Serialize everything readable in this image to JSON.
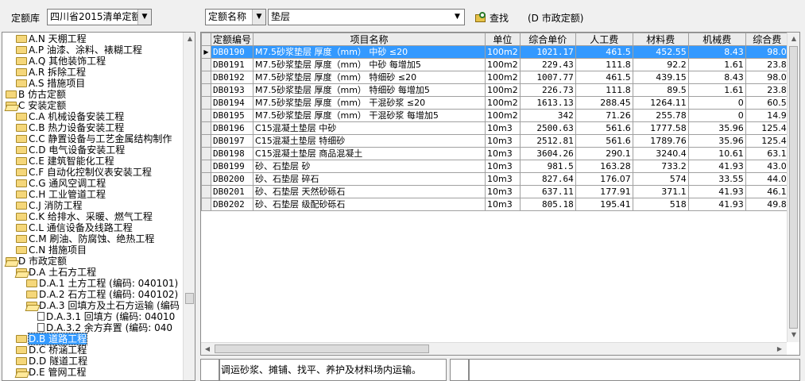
{
  "toolbar": {
    "library_label": "定额库",
    "library_value": "四川省2015清单定额",
    "field_value": "定额名称",
    "search_value": "垫层",
    "find_label": "查找",
    "status": "(D 市政定额)"
  },
  "tree": {
    "rows": [
      {
        "label": "A.N 天棚工程",
        "type": "folder"
      },
      {
        "label": "A.P 油漆、涂料、裱糊工程",
        "type": "folder"
      },
      {
        "label": "A.Q 其他装饰工程",
        "type": "folder"
      },
      {
        "label": "A.R 拆除工程",
        "type": "folder"
      },
      {
        "label": "A.S 措施项目",
        "type": "folder"
      },
      {
        "label": "B 仿古定额",
        "type": "folder"
      },
      {
        "label": "C 安装定额",
        "type": "folder-open"
      },
      {
        "label": "C.A 机械设备安装工程",
        "type": "folder"
      },
      {
        "label": "C.B 热力设备安装工程",
        "type": "folder"
      },
      {
        "label": "C.C 静置设备与工艺金属结构制作",
        "type": "folder"
      },
      {
        "label": "C.D 电气设备安装工程",
        "type": "folder"
      },
      {
        "label": "C.E 建筑智能化工程",
        "type": "folder"
      },
      {
        "label": "C.F 自动化控制仪表安装工程",
        "type": "folder"
      },
      {
        "label": "C.G 通风空调工程",
        "type": "folder"
      },
      {
        "label": "C.H 工业管道工程",
        "type": "folder"
      },
      {
        "label": "C.J 消防工程",
        "type": "folder"
      },
      {
        "label": "C.K 给排水、采暖、燃气工程",
        "type": "folder"
      },
      {
        "label": "C.L 通信设备及线路工程",
        "type": "folder"
      },
      {
        "label": "C.M 刷油、防腐蚀、绝热工程",
        "type": "folder"
      },
      {
        "label": "C.N 措施项目",
        "type": "folder"
      },
      {
        "label": "D 市政定额",
        "type": "folder-open"
      },
      {
        "label": "D.A 土石方工程",
        "type": "folder-open"
      },
      {
        "label": "D.A.1 土方工程 (编码: 040101)",
        "type": "folder"
      },
      {
        "label": "D.A.2 石方工程 (编码: 040102)",
        "type": "folder"
      },
      {
        "label": "D.A.3 回填方及土石方运输 (编码",
        "type": "folder-open"
      },
      {
        "label": "D.A.3.1 回填方 (编码: 04010",
        "type": "doc"
      },
      {
        "label": "D.A.3.2 余方弃置 (编码: 040",
        "type": "doc"
      },
      {
        "label": "D.B 道路工程",
        "type": "folder",
        "selected": true
      },
      {
        "label": "D.C 桥涵工程",
        "type": "folder"
      },
      {
        "label": "D.D 隧道工程",
        "type": "folder"
      },
      {
        "label": "D.E 管网工程",
        "type": "folder-open"
      }
    ]
  },
  "grid": {
    "columns": [
      "定额编号",
      "项目名称",
      "单位",
      "综合单价",
      "人工费",
      "材料费",
      "机械费",
      "综合费"
    ],
    "rows": [
      {
        "selected": true,
        "cells": [
          "DB0190",
          "M7.5砂浆垫层 厚度（mm） 中砂 ≤20",
          "100m2",
          "1021.17",
          "461.5",
          "452.55",
          "8.43",
          "98.0"
        ]
      },
      {
        "cells": [
          "DB0191",
          "M7.5砂浆垫层 厚度（mm） 中砂 每增加5",
          "100m2",
          "229.43",
          "111.8",
          "92.2",
          "1.61",
          "23.8"
        ]
      },
      {
        "cells": [
          "DB0192",
          "M7.5砂浆垫层 厚度（mm） 特细砂 ≤20",
          "100m2",
          "1007.77",
          "461.5",
          "439.15",
          "8.43",
          "98.0"
        ]
      },
      {
        "cells": [
          "DB0193",
          "M7.5砂浆垫层 厚度（mm） 特细砂 每增加5",
          "100m2",
          "226.73",
          "111.8",
          "89.5",
          "1.61",
          "23.8"
        ]
      },
      {
        "cells": [
          "DB0194",
          "M7.5砂浆垫层 厚度（mm） 干混砂浆 ≤20",
          "100m2",
          "1613.13",
          "288.45",
          "1264.11",
          "0",
          "60.5"
        ]
      },
      {
        "cells": [
          "DB0195",
          "M7.5砂浆垫层 厚度（mm） 干混砂浆 每增加5",
          "100m2",
          "342",
          "71.26",
          "255.78",
          "0",
          "14.9"
        ]
      },
      {
        "cells": [
          "DB0196",
          "C15混凝土垫层 中砂",
          "10m3",
          "2500.63",
          "561.6",
          "1777.58",
          "35.96",
          "125.4"
        ]
      },
      {
        "cells": [
          "DB0197",
          "C15混凝土垫层 特细砂",
          "10m3",
          "2512.81",
          "561.6",
          "1789.76",
          "35.96",
          "125.4"
        ]
      },
      {
        "cells": [
          "DB0198",
          "C15混凝土垫层 商品混凝土",
          "10m3",
          "3604.26",
          "290.1",
          "3240.4",
          "10.61",
          "63.1"
        ]
      },
      {
        "cells": [
          "DB0199",
          "砂、石垫层 砂",
          "10m3",
          "981.5",
          "163.28",
          "733.2",
          "41.93",
          "43.0"
        ]
      },
      {
        "cells": [
          "DB0200",
          "砂、石垫层 碎石",
          "10m3",
          "827.64",
          "176.07",
          "574",
          "33.55",
          "44.0"
        ]
      },
      {
        "cells": [
          "DB0201",
          "砂、石垫层 天然砂砾石",
          "10m3",
          "637.11",
          "177.91",
          "371.1",
          "41.93",
          "46.1"
        ]
      },
      {
        "cells": [
          "DB0202",
          "砂、石垫层 级配砂砾石",
          "10m3",
          "805.18",
          "195.41",
          "518",
          "41.93",
          "49.8"
        ]
      }
    ]
  },
  "description": "调运砂浆、摊铺、找平、养护及材料场内运输。"
}
